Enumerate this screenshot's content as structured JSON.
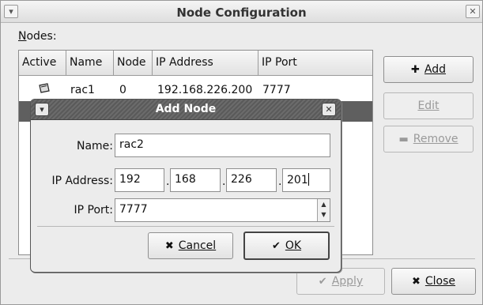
{
  "window": {
    "title": "Node Configuration",
    "menu_glyph": "⌄",
    "close_glyph": "×"
  },
  "nodes": {
    "label": "Nodes:",
    "columns": [
      "Active",
      "Name",
      "Node",
      "IP Address",
      "IP Port"
    ],
    "rows": [
      {
        "active_icon": "server-icon",
        "name": "rac1",
        "node": "0",
        "ip": "192.168.226.200",
        "port": "7777"
      }
    ]
  },
  "buttons": {
    "add": "Add",
    "edit": "Edit",
    "remove": "Remove",
    "apply": "Apply",
    "close": "Close"
  },
  "dialog": {
    "title": "Add Node",
    "name_label": "Name:",
    "name_value": "rac2",
    "ip_label": "IP Address:",
    "ip_octets": [
      "192",
      "168",
      "226",
      "201"
    ],
    "port_label": "IP Port:",
    "port_value": "7777",
    "cancel": "Cancel",
    "ok": "OK"
  },
  "colors": {
    "selected_row": "#5f5f5f",
    "dialog_title": "#5f5f5f"
  }
}
